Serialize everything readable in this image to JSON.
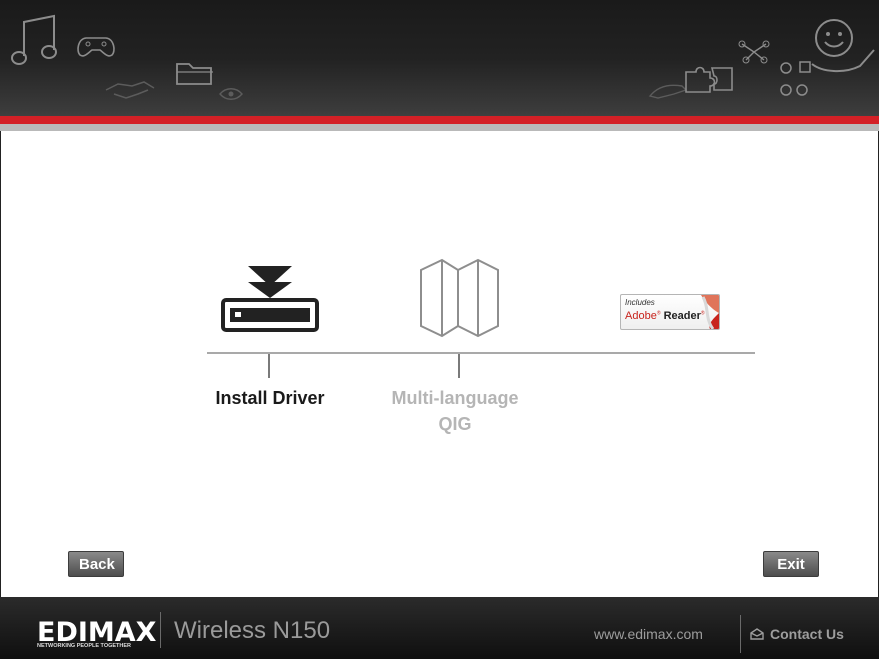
{
  "header": {
    "decorative_icons": [
      "music-note-icon",
      "game-controller-icon",
      "handshake-icon",
      "folder-icon",
      "eye-icon",
      "hand-icon",
      "puzzle-icon",
      "molecule-icon",
      "nodes-icon",
      "smiley-hand-icon"
    ]
  },
  "main": {
    "items": [
      {
        "label": "Install Driver",
        "icon": "install-driver-icon",
        "state": "active"
      },
      {
        "label": "Multi-language\nQIG",
        "label_line1": "Multi-language",
        "label_line2": "QIG",
        "icon": "map-icon",
        "state": "disabled"
      },
      {
        "badge_includes": "Includes",
        "badge_adobe": "Adobe",
        "badge_reader": "Reader",
        "icon": "adobe-reader-icon"
      }
    ]
  },
  "nav": {
    "back": "Back",
    "exit": "Exit"
  },
  "footer": {
    "logo": "EDIMAX",
    "logo_tagline": "NETWORKING PEOPLE TOGETHER",
    "product": "Wireless N150",
    "website": "www.edimax.com",
    "contact": "Contact Us"
  },
  "colors": {
    "accent_red": "#d32026",
    "active_text": "#1a1a1a",
    "disabled_text": "#b5b5b5"
  }
}
